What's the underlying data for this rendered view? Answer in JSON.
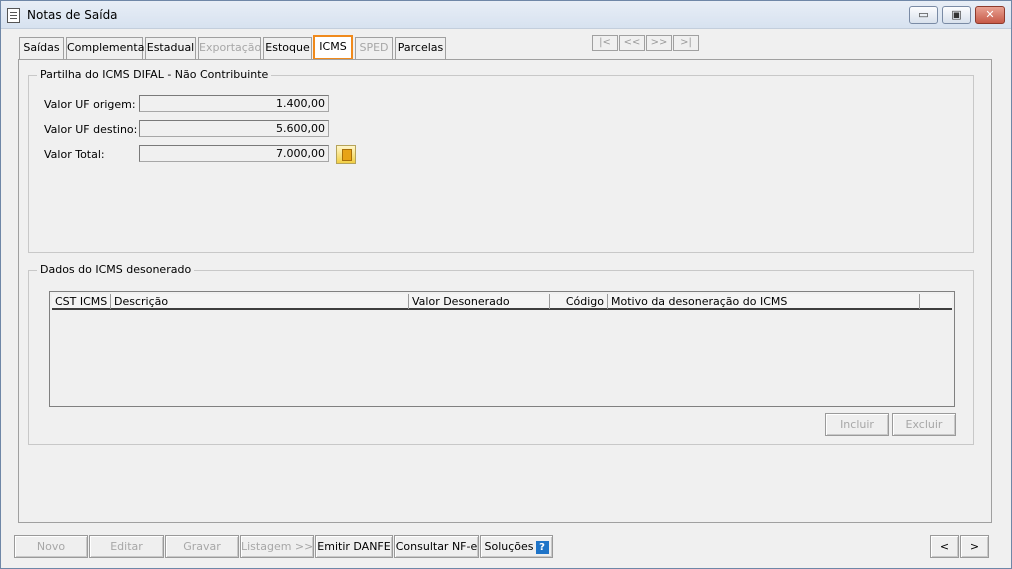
{
  "window": {
    "title": "Notas de Saída",
    "icon": "document-icon",
    "controls": {
      "minimize": "▭",
      "maximize": "▣",
      "close": "✕"
    }
  },
  "tabs": [
    {
      "label": "Saídas",
      "state": "normal"
    },
    {
      "label": "Complementar",
      "state": "normal"
    },
    {
      "label": "Estadual",
      "state": "normal"
    },
    {
      "label": "Exportação",
      "state": "disabled"
    },
    {
      "label": "Estoque",
      "state": "normal"
    },
    {
      "label": "ICMS",
      "state": "active"
    },
    {
      "label": "SPED",
      "state": "disabled"
    },
    {
      "label": "Parcelas",
      "state": "normal"
    }
  ],
  "record_nav": {
    "first": "|<",
    "prev": "<<",
    "next": ">>",
    "last": ">|"
  },
  "partilha": {
    "title": "Partilha do ICMS DIFAL - Não Contribuinte",
    "uf_origem_label": "Valor UF origem:",
    "uf_origem_value": "1.400,00",
    "uf_destino_label": "Valor UF destino:",
    "uf_destino_value": "5.600,00",
    "total_label": "Valor Total:",
    "total_value": "7.000,00",
    "calculator_icon": "calculator-icon"
  },
  "desonerado": {
    "title": "Dados do ICMS desonerado",
    "columns": [
      "CST ICMS",
      "Descrição",
      "Valor Desonerado",
      "Código",
      "Motivo da desoneração do ICMS"
    ],
    "rows": [],
    "incluir_label": "Incluir",
    "excluir_label": "Excluir"
  },
  "bottom_toolbar": {
    "novo": "Novo",
    "editar": "Editar",
    "gravar": "Gravar",
    "listagem": "Listagem >>",
    "emitir_danfe": "Emitir DANFE",
    "consultar_nfe": "Consultar NF-e",
    "solucoes": "Soluções",
    "help_icon": "?",
    "prev": "<",
    "next": ">"
  },
  "colors": {
    "active_tab_border": "#f08a1c",
    "disabled_text": "#a7a7a7"
  }
}
